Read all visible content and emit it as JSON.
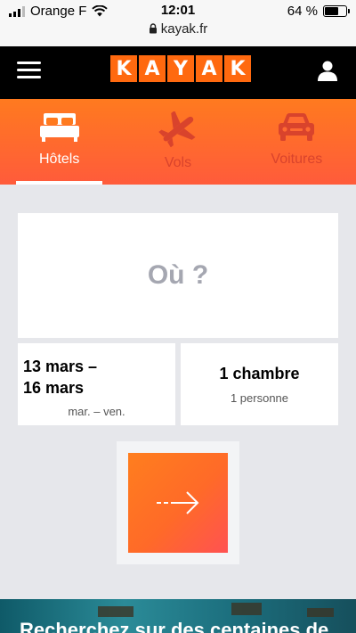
{
  "status_bar": {
    "carrier": "Orange F",
    "time": "12:01",
    "url": "kayak.fr",
    "battery_percent_label": "64 %",
    "battery_level": 0.64
  },
  "header": {
    "logo_letters": [
      "K",
      "A",
      "Y",
      "A",
      "K"
    ],
    "menu_icon": "hamburger-icon",
    "user_icon": "user-icon"
  },
  "tabs": [
    {
      "label": "Hôtels",
      "icon": "bed-icon",
      "active": true
    },
    {
      "label": "Vols",
      "icon": "plane-icon",
      "active": false
    },
    {
      "label": "Voitures",
      "icon": "car-icon",
      "active": false
    }
  ],
  "search_form": {
    "destination_placeholder": "Où ?",
    "date_range": "13 mars –\n16 mars",
    "date_days": "mar. – ven.",
    "rooms": "1 chambre",
    "guests": "1 personne",
    "submit_icon": "arrow-right-icon"
  },
  "promo": {
    "text": "Recherchez sur des centaines de"
  },
  "colors": {
    "brand_orange": "#ff690f",
    "tab_gradient_top": "#ff7a1f",
    "tab_gradient_bottom": "#ff5b3b",
    "inactive_tab": "#d9432c",
    "page_bg": "#e6e7eb"
  }
}
